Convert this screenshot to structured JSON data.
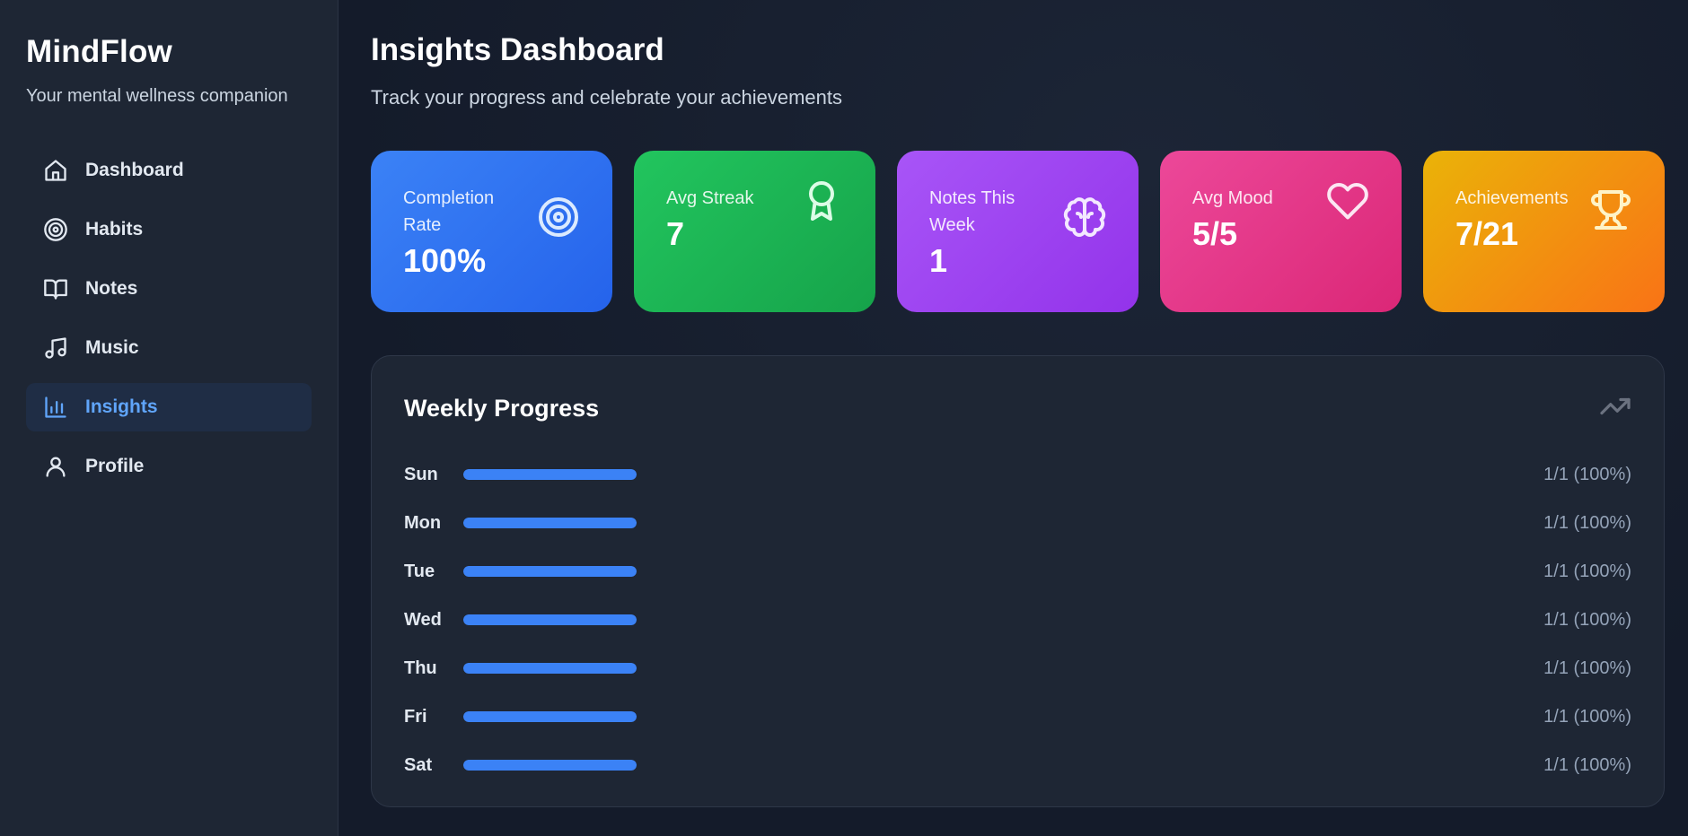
{
  "sidebar": {
    "brand": "MindFlow",
    "tagline": "Your mental wellness companion",
    "items": [
      {
        "label": "Dashboard",
        "icon": "home-icon",
        "active": false
      },
      {
        "label": "Habits",
        "icon": "target-icon",
        "active": false
      },
      {
        "label": "Notes",
        "icon": "book-icon",
        "active": false
      },
      {
        "label": "Music",
        "icon": "music-icon",
        "active": false
      },
      {
        "label": "Insights",
        "icon": "bar-chart-icon",
        "active": true
      },
      {
        "label": "Profile",
        "icon": "user-icon",
        "active": false
      }
    ]
  },
  "header": {
    "title": "Insights Dashboard",
    "subtitle": "Track your progress and celebrate your achievements"
  },
  "stats": [
    {
      "label": "Completion Rate",
      "value": "100%",
      "icon": "target-icon",
      "color": "#3b82f6"
    },
    {
      "label": "Avg Streak",
      "value": "7",
      "icon": "award-icon",
      "color": "#22c55e"
    },
    {
      "label": "Notes This Week",
      "value": "1",
      "icon": "brain-icon",
      "color": "#a855f7"
    },
    {
      "label": "Avg Mood",
      "value": "5/5",
      "icon": "heart-icon",
      "color": "#ec4899"
    },
    {
      "label": "Achievements",
      "value": "7/21",
      "icon": "trophy-icon",
      "color": "#f59e0b"
    }
  ],
  "weekly": {
    "title": "Weekly Progress",
    "icon": "trending-up-icon",
    "days": [
      {
        "day": "Sun",
        "value": "1/1 (100%)",
        "progress": 1.0
      },
      {
        "day": "Mon",
        "value": "1/1 (100%)",
        "progress": 1.0
      },
      {
        "day": "Tue",
        "value": "1/1 (100%)",
        "progress": 1.0
      },
      {
        "day": "Wed",
        "value": "1/1 (100%)",
        "progress": 1.0
      },
      {
        "day": "Thu",
        "value": "1/1 (100%)",
        "progress": 1.0
      },
      {
        "day": "Fri",
        "value": "1/1 (100%)",
        "progress": 1.0
      },
      {
        "day": "Sat",
        "value": "1/1 (100%)",
        "progress": 1.0
      }
    ]
  }
}
